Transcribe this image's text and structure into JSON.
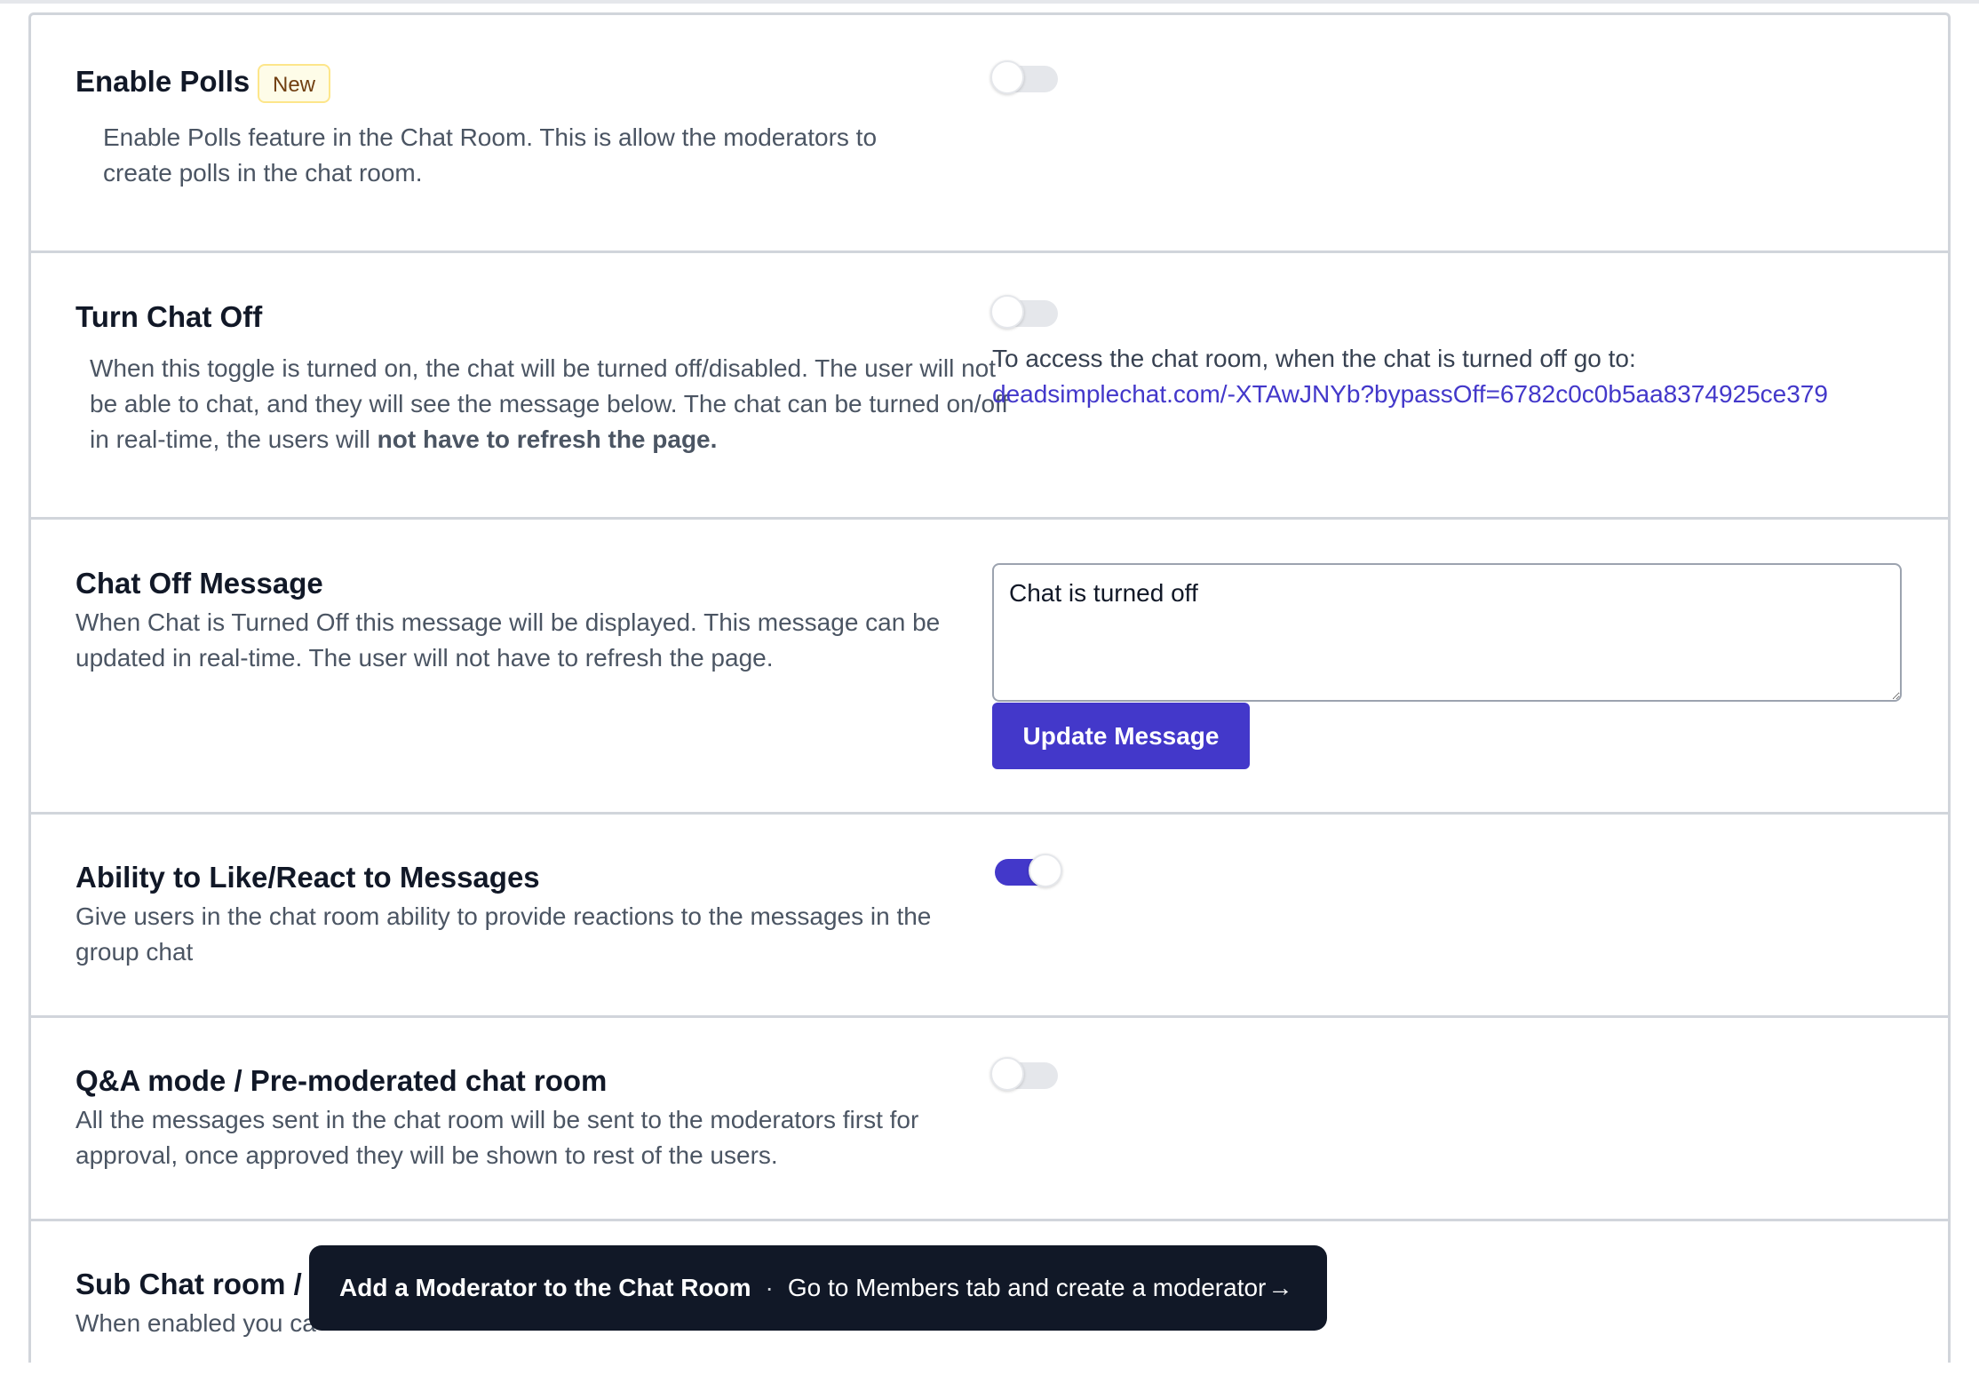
{
  "sections": {
    "polls": {
      "title": "Enable Polls",
      "badge": "New",
      "description": "Enable Polls feature in the Chat Room. This is allow the moderators to create polls in the chat room.",
      "toggle_on": false
    },
    "chat_off": {
      "title": "Turn Chat Off",
      "description_prefix": "When this toggle is turned on, the chat will be turned off/disabled. The user will not be able to chat, and they will see the message below. The chat can be turned on/off in real-time, the users will ",
      "description_bold": "not have to refresh the page.",
      "toggle_on": false,
      "access_text": "To access the chat room, when the chat is turned off go to:",
      "access_link": "deadsimplechat.com/-XTAwJNYb?bypassOff=6782c0c0b5aa8374925ce379"
    },
    "chat_off_message": {
      "title": "Chat Off Message",
      "description": "When Chat is Turned Off this message will be displayed. This message can be updated in real-time. The user will not have to refresh the page.",
      "message_value": "Chat is turned off",
      "button_label": "Update Message"
    },
    "reactions": {
      "title": "Ability to Like/React to Messages",
      "description": "Give users in the chat room ability to provide reactions to the messages in the group chat",
      "toggle_on": true
    },
    "qa_mode": {
      "title": "Q&A mode / Pre-moderated chat room",
      "description": "All the messages sent in the chat room will be sent to the moderators first for approval, once approved they will be shown to rest of the users.",
      "toggle_on": false
    },
    "sub_chat": {
      "title": "Sub Chat room / C",
      "description": "When enabled you ca"
    }
  },
  "toast": {
    "title": "Add a Moderator to the Chat Room",
    "separator": "·",
    "message": "Go to Members tab and create a moderator",
    "arrow": "→"
  },
  "colors": {
    "accent": "#4338ca",
    "toast_bg": "#111827",
    "badge_bg": "#fefce8",
    "badge_text": "#713f12",
    "border": "#d1d5db"
  }
}
